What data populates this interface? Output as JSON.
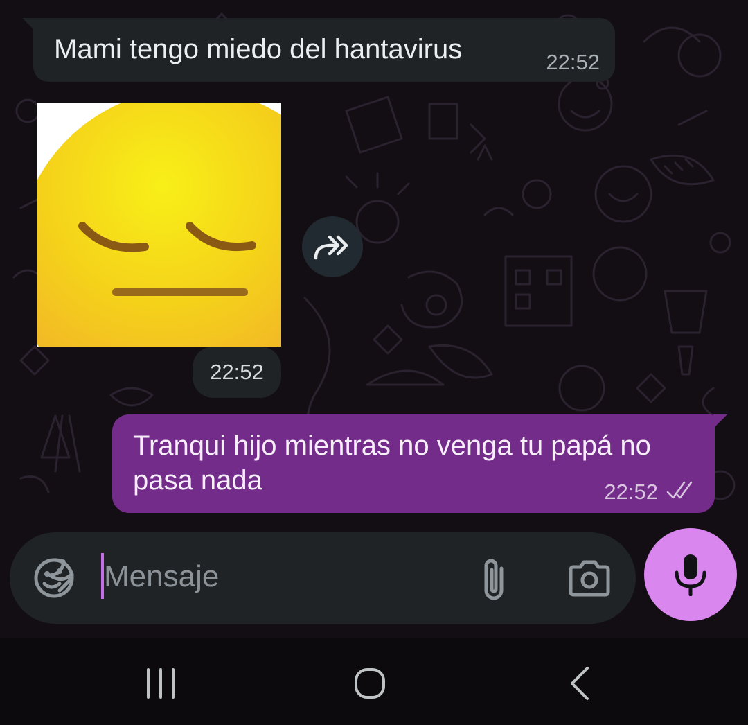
{
  "messages": {
    "incoming_text": "Mami tengo miedo del hantavirus",
    "incoming_time": "22:52",
    "sticker_time": "22:52",
    "outgoing_text": "Tranqui hijo mientras no venga tu papá no pasa nada",
    "outgoing_time": "22:52",
    "outgoing_status": "read"
  },
  "composer": {
    "placeholder": "Mensaje"
  },
  "icons": {
    "forward": "forward-icon",
    "emoji": "sticker-emoji-icon",
    "attach": "paperclip-icon",
    "camera": "camera-icon",
    "mic": "microphone-icon",
    "nav_recent": "recent-apps-icon",
    "nav_home": "home-icon",
    "nav_back": "back-icon",
    "ticks": "double-check-icon"
  },
  "colors": {
    "outgoing_bubble": "#732c89",
    "incoming_bubble": "#1f2326",
    "mic_button": "#d986ee",
    "caret": "#c76ce8",
    "background": "#120e13"
  }
}
